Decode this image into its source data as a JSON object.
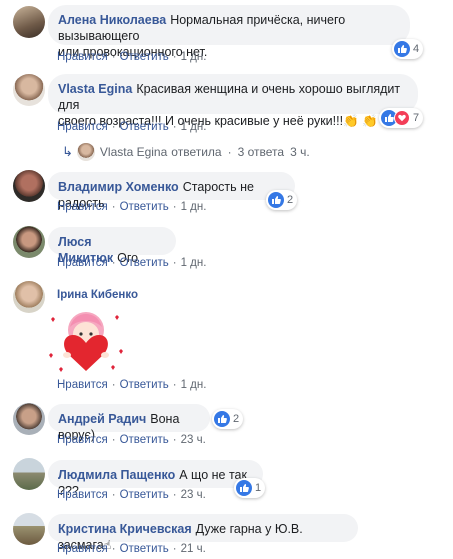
{
  "comments": [
    {
      "name": "Алена Николаева",
      "text_line1": "Нормальная причёска, ничего вызывающего",
      "text_line2": "или провокационного нет.",
      "like": "Нравится",
      "reply": "Ответить",
      "time": "1 дн.",
      "count": "4"
    },
    {
      "name": "Vlasta Egina",
      "text_line1": "Красивая женщина и очень хорошо выглядит для",
      "text_line2": "своего возраста!!! И очень красивые у неё руки!!!👏 👏 👏",
      "like": "Нравится",
      "reply": "Ответить",
      "time": "1 дн.",
      "count": "7"
    },
    {
      "name": "Владимир Хоменко",
      "text": "Старость не радость",
      "like": "Нравится",
      "reply": "Ответить",
      "time": "1 дн.",
      "count": "2"
    },
    {
      "name": "Люся Микитюк",
      "text": "Ого",
      "like": "Нравится",
      "reply": "Ответить",
      "time": "1 дн."
    },
    {
      "name": "Ірина Кибенко",
      "like": "Нравится",
      "reply": "Ответить",
      "time": "1 дн."
    },
    {
      "name": "Андрей Радич",
      "text": "Вона ворує)",
      "like": "Нравится",
      "reply": "Ответить",
      "time": "23 ч.",
      "count": "2"
    },
    {
      "name": "Людмила Пащенко",
      "text": "А що не так ???",
      "like": "Нравится",
      "reply": "Ответить",
      "time": "23 ч.",
      "count": "1"
    },
    {
      "name": "Кристина Кричевская",
      "text": "Дуже гарна у Ю.В. засмага☝",
      "like": "Нравится",
      "reply": "Ответить",
      "time": "21 ч."
    }
  ],
  "reply_summary": {
    "name": "Vlasta Egina",
    "action": "ответила",
    "replies": "3 ответа",
    "time": "3 ч."
  },
  "colors": {
    "link": "#385898",
    "bubble": "#f2f3f5",
    "like": "#3578e5",
    "love": "#f33e58"
  }
}
